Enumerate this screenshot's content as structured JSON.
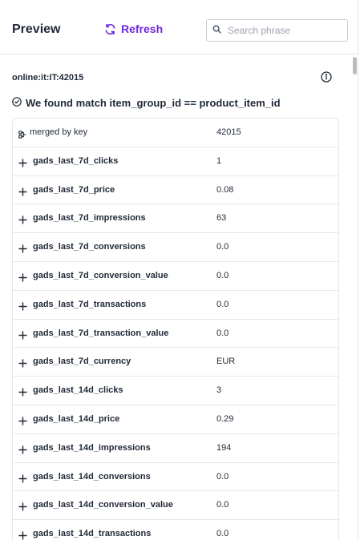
{
  "header": {
    "title": "Preview",
    "refresh_label": "Refresh",
    "search_placeholder": "Search phrase",
    "search_value": ""
  },
  "record": {
    "id": "online:it:IT:42015",
    "match_text": "We found match item_group_id == product_item_id"
  },
  "rows": [
    {
      "key": "merged by key",
      "value": "42015"
    },
    {
      "key": "gads_last_7d_clicks",
      "value": "1"
    },
    {
      "key": "gads_last_7d_price",
      "value": "0.08"
    },
    {
      "key": "gads_last_7d_impressions",
      "value": "63"
    },
    {
      "key": "gads_last_7d_conversions",
      "value": "0.0"
    },
    {
      "key": "gads_last_7d_conversion_value",
      "value": "0.0"
    },
    {
      "key": "gads_last_7d_transactions",
      "value": "0.0"
    },
    {
      "key": "gads_last_7d_transaction_value",
      "value": "0.0"
    },
    {
      "key": "gads_last_7d_currency",
      "value": "EUR"
    },
    {
      "key": "gads_last_14d_clicks",
      "value": "3"
    },
    {
      "key": "gads_last_14d_price",
      "value": "0.29"
    },
    {
      "key": "gads_last_14d_impressions",
      "value": "194"
    },
    {
      "key": "gads_last_14d_conversions",
      "value": "0.0"
    },
    {
      "key": "gads_last_14d_conversion_value",
      "value": "0.0"
    },
    {
      "key": "gads_last_14d_transactions",
      "value": "0.0"
    }
  ],
  "icons": {
    "refresh": "refresh-icon",
    "search": "search-icon",
    "info": "info-icon",
    "match": "check-circle-icon",
    "merge": "merge-key-icon",
    "expand": "plus-icon"
  },
  "colors": {
    "accent": "#6d28d9",
    "text": "#1f2937",
    "border": "#e5e7eb"
  }
}
